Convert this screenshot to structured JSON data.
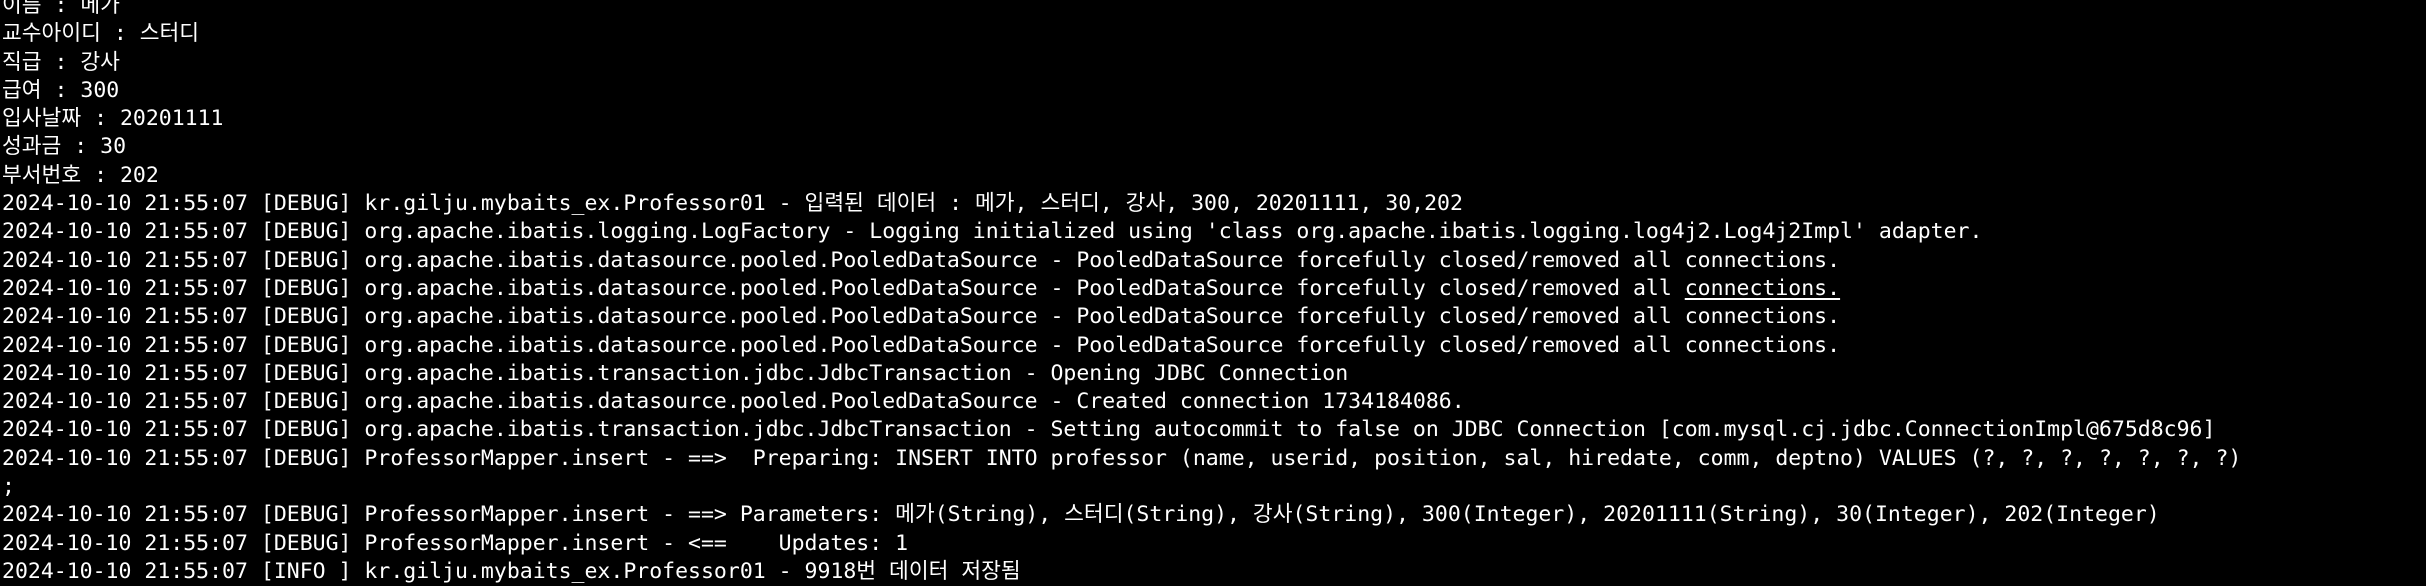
{
  "terminal": {
    "lines": [
      "이름 : 메가",
      "교수아이디 : 스터디",
      "직급 : 강사",
      "급여 : 300",
      "입사날짜 : 20201111",
      "성과금 : 30",
      "부서번호 : 202",
      "2024-10-10 21:55:07 [DEBUG] kr.gilju.mybaits_ex.Professor01 - 입력된 데이터 : 메가, 스터디, 강사, 300, 20201111, 30,202",
      "2024-10-10 21:55:07 [DEBUG] org.apache.ibatis.logging.LogFactory - Logging initialized using 'class org.apache.ibatis.logging.log4j2.Log4j2Impl' adapter.",
      "2024-10-10 21:55:07 [DEBUG] org.apache.ibatis.datasource.pooled.PooledDataSource - PooledDataSource forcefully closed/removed all connections.",
      "2024-10-10 21:55:07 [DEBUG] org.apache.ibatis.datasource.pooled.PooledDataSource - PooledDataSource forcefully closed/removed all ",
      "2024-10-10 21:55:07 [DEBUG] org.apache.ibatis.datasource.pooled.PooledDataSource - PooledDataSource forcefully closed/removed all connections.",
      "2024-10-10 21:55:07 [DEBUG] org.apache.ibatis.datasource.pooled.PooledDataSource - PooledDataSource forcefully closed/removed all connections.",
      "2024-10-10 21:55:07 [DEBUG] org.apache.ibatis.transaction.jdbc.JdbcTransaction - Opening JDBC Connection",
      "2024-10-10 21:55:07 [DEBUG] org.apache.ibatis.datasource.pooled.PooledDataSource - Created connection 1734184086.",
      "2024-10-10 21:55:07 [DEBUG] org.apache.ibatis.transaction.jdbc.JdbcTransaction - Setting autocommit to false on JDBC Connection [com.mysql.cj.jdbc.ConnectionImpl@675d8c96]",
      "2024-10-10 21:55:07 [DEBUG] ProfessorMapper.insert - ==>  Preparing: INSERT INTO professor (name, userid, position, sal, hiredate, comm, deptno) VALUES (?, ?, ?, ?, ?, ?, ?)",
      ";",
      "2024-10-10 21:55:07 [DEBUG] ProfessorMapper.insert - ==> Parameters: 메가(String), 스터디(String), 강사(String), 300(Integer), 20201111(String), 30(Integer), 202(Integer)",
      "2024-10-10 21:55:07 [DEBUG] ProfessorMapper.insert - <==    Updates: 1",
      "2024-10-10 21:55:07 [INFO ] kr.gilju.mybaits_ex.Professor01 - 9918번 데이터 저장됨"
    ],
    "underlined_link": "connections."
  }
}
